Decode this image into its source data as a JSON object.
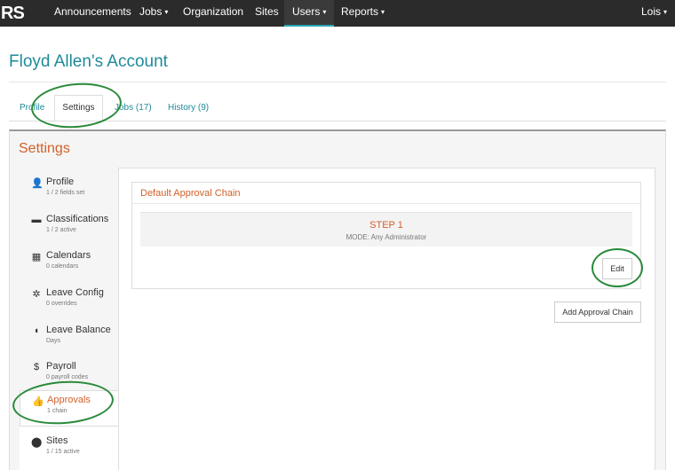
{
  "nav": {
    "logo": "RS",
    "items": [
      {
        "label": "Announcements",
        "caret": ""
      },
      {
        "label": "Jobs",
        "caret": "▾"
      },
      {
        "label": "Organization",
        "caret": ""
      },
      {
        "label": "Sites",
        "caret": ""
      },
      {
        "label": "Users",
        "caret": "▾"
      },
      {
        "label": "Reports",
        "caret": "▾"
      }
    ],
    "user": {
      "label": "Lois",
      "caret": "▾"
    },
    "active_accent": "#2aa7b4"
  },
  "page": {
    "title": "Floyd Allen's Account"
  },
  "tabs": [
    {
      "label": "Profile"
    },
    {
      "label": "Settings"
    },
    {
      "label": "Jobs (17)"
    },
    {
      "label": "History (9)"
    }
  ],
  "settings": {
    "title": "Settings",
    "sidebar": [
      {
        "label": "Profile",
        "sub": "1 / 2 fields set",
        "icon": "user-icon",
        "glyph": "👤"
      },
      {
        "label": "Classifications",
        "sub": "1 / 2 active",
        "icon": "folder-icon",
        "glyph": "▬"
      },
      {
        "label": "Calendars",
        "sub": "0 calendars",
        "icon": "calendar-icon",
        "glyph": "▦"
      },
      {
        "label": "Leave Config",
        "sub": "0 overrides",
        "icon": "gear-icon",
        "glyph": "✲"
      },
      {
        "label": "Leave Balance",
        "sub": "Days",
        "icon": "piggy-bank-icon",
        "glyph": "◖"
      },
      {
        "label": "Payroll",
        "sub": "0 payroll codes",
        "icon": "dollar-icon",
        "glyph": "$"
      },
      {
        "label": "Approvals",
        "sub": "1 chain",
        "icon": "thumbs-up-icon",
        "glyph": "👍"
      },
      {
        "label": "Sites",
        "sub": "1 / 15 active",
        "icon": "map-marker-icon",
        "glyph": "⬤"
      }
    ]
  },
  "approval": {
    "chain_title": "Default Approval Chain",
    "step_title": "STEP 1",
    "step_mode": "MODE: Any Administrator",
    "edit_label": "Edit",
    "add_label": "Add Approval Chain"
  },
  "colors": {
    "title_teal": "#1f8a99",
    "accent_orange": "#d2602a",
    "annotation_green": "#2a8a3a"
  }
}
